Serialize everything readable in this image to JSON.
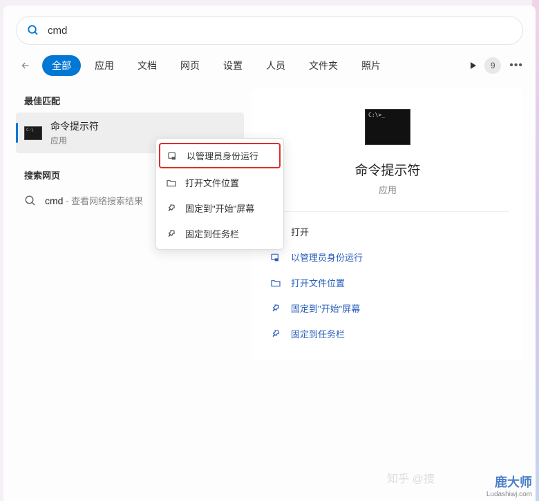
{
  "search": {
    "value": "cmd"
  },
  "filters": {
    "items": [
      "全部",
      "应用",
      "文档",
      "网页",
      "设置",
      "人员",
      "文件夹",
      "照片"
    ],
    "active_index": 0,
    "badge": "9"
  },
  "left": {
    "best_match_header": "最佳匹配",
    "best_match": {
      "name": "命令提示符",
      "type": "应用"
    },
    "web_header": "搜索网页",
    "web_result": {
      "term": "cmd",
      "suffix": " - 查看网络搜索结果"
    }
  },
  "context_menu": {
    "items": [
      {
        "icon": "admin",
        "label": "以管理员身份运行",
        "highlighted": true
      },
      {
        "icon": "folder",
        "label": "打开文件位置",
        "highlighted": false
      },
      {
        "icon": "pin",
        "label": "固定到\"开始\"屏幕",
        "highlighted": false
      },
      {
        "icon": "pin",
        "label": "固定到任务栏",
        "highlighted": false
      }
    ]
  },
  "preview": {
    "title": "命令提示符",
    "type": "应用",
    "actions": [
      {
        "icon": "open",
        "label": "打开",
        "blue": false
      },
      {
        "icon": "admin",
        "label": "以管理员身份运行",
        "blue": true
      },
      {
        "icon": "folder",
        "label": "打开文件位置",
        "blue": true
      },
      {
        "icon": "pin",
        "label": "固定到\"开始\"屏幕",
        "blue": true
      },
      {
        "icon": "pin",
        "label": "固定到任务栏",
        "blue": true
      }
    ]
  },
  "watermarks": {
    "w1": "知乎 @捜",
    "w2": "鹿大师",
    "w2sub": "Ludashiwj.com"
  }
}
